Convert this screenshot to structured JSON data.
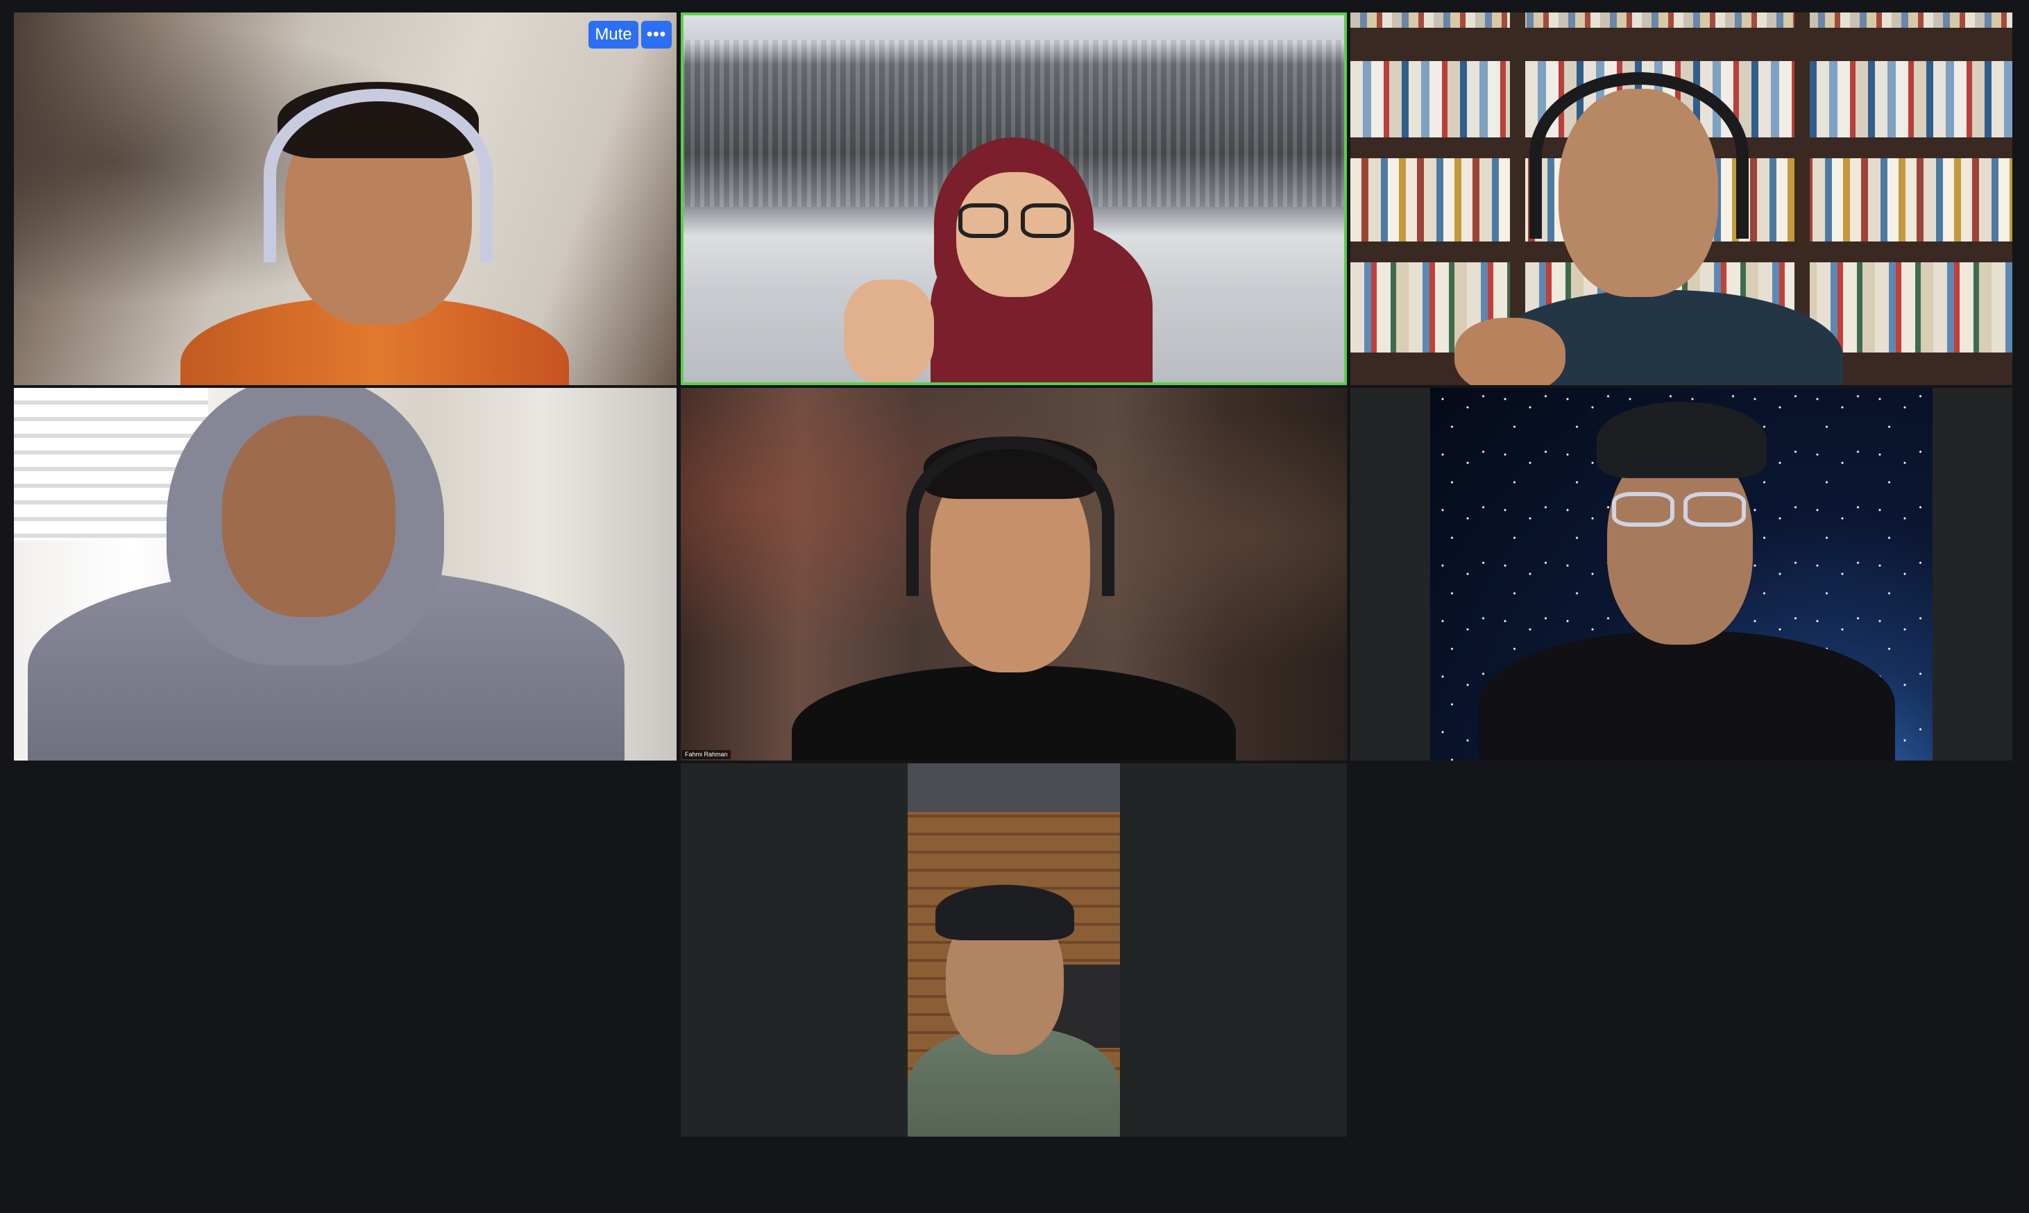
{
  "controls": {
    "mute_label": "Mute",
    "more_icon": "more-horizontal-icon",
    "more_label": "•••"
  },
  "participants": [
    {
      "name": "",
      "active": false
    },
    {
      "name": "",
      "active": true
    },
    {
      "name": "",
      "active": false
    },
    {
      "name": "",
      "active": false
    },
    {
      "name": "Fahmi Rahman",
      "active": false
    },
    {
      "name": "",
      "active": false
    },
    {
      "name": "",
      "active": false
    }
  ],
  "colors": {
    "background": "#141518",
    "tile": "#232425",
    "active_speaker_border": "#5bd04d",
    "button": "#2d6ff2"
  }
}
